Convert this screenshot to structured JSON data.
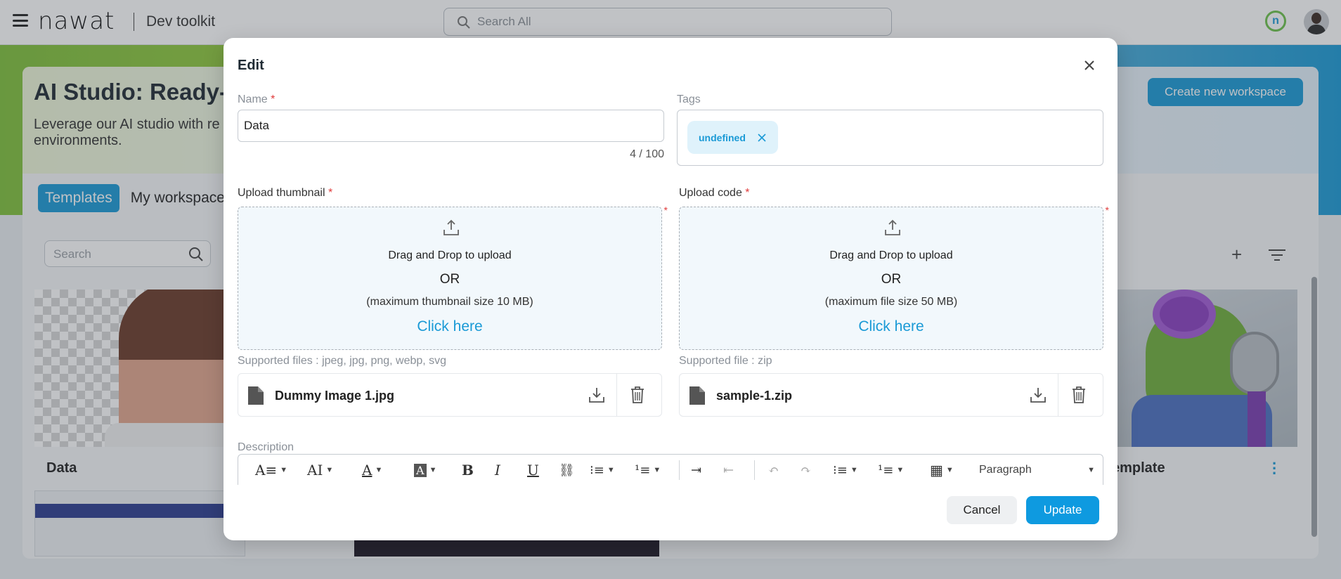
{
  "app": {
    "logo": "nawat",
    "subtitle": "Dev toolkit",
    "search_placeholder": "Search All",
    "profile_initial": "n"
  },
  "background": {
    "hero_title": "AI Studio: Ready-t",
    "hero_desc": "Leverage our AI studio with re environments.",
    "create_button": "Create new workspace",
    "tabs": [
      "Templates",
      "My workspace"
    ],
    "search_placeholder": "Search",
    "cards": [
      {
        "name": "Data"
      },
      {
        "name": "emplate"
      }
    ]
  },
  "modal": {
    "title": "Edit",
    "name": {
      "label": "Name",
      "required": "*",
      "value": "Data",
      "counter": "4 / 100"
    },
    "tags": {
      "label": "Tags",
      "chips": [
        "undefined"
      ]
    },
    "thumbnail": {
      "label": "Upload thumbnail",
      "required": "*",
      "drag_text": "Drag and Drop to upload",
      "or_text": "OR",
      "limit_text": "(maximum thumbnail size 10 MB)",
      "click_text": "Click here",
      "supported": "Supported files : jpeg, jpg, png, webp, svg",
      "file_name": "Dummy Image 1.jpg"
    },
    "code": {
      "label": "Upload code",
      "required": "*",
      "drag_text": "Drag and Drop to upload",
      "or_text": "OR",
      "limit_text": "(maximum file size 50 MB)",
      "click_text": "Click here",
      "supported": "Supported file : zip",
      "file_name": "sample-1.zip"
    },
    "description": {
      "label": "Description",
      "block_format": "Paragraph"
    },
    "buttons": {
      "cancel": "Cancel",
      "update": "Update"
    }
  },
  "colors": {
    "accent": "#1a9ad6",
    "required": "#e03a3a",
    "chip_bg": "#dff2fb"
  }
}
